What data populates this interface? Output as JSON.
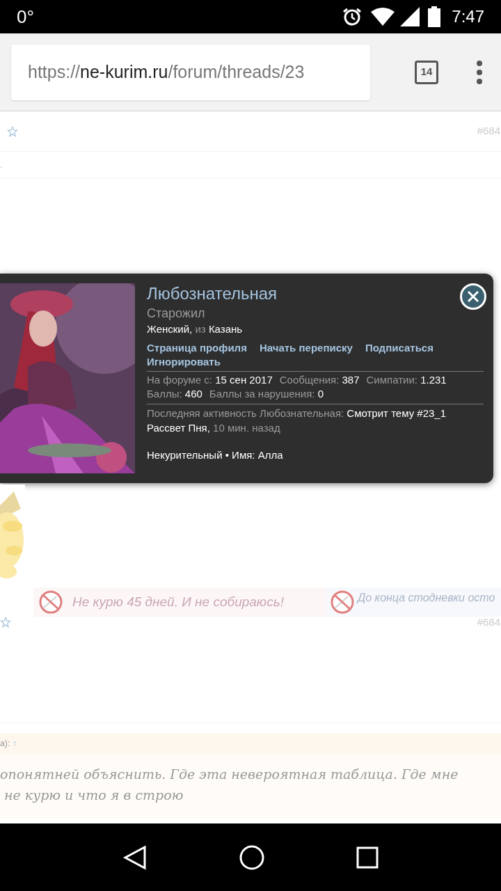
{
  "status_bar": {
    "temperature": "0°",
    "time": "7:47"
  },
  "browser": {
    "url_scheme": "https://",
    "url_host": "ne-kurim.ru",
    "url_path": "/forum/threads/23",
    "tab_count": "14"
  },
  "top_post": {
    "post_number": "#684",
    "fragment": "."
  },
  "popup": {
    "name": "Любознательная",
    "rank": "Старожил",
    "gender": "Женский,",
    "from": "из",
    "city": "Казань",
    "links": [
      "Страница профиля",
      "Начать переписку",
      "Подписаться",
      "Игнорировать"
    ],
    "stats": [
      [
        {
          "label": "На форуме с:",
          "value": "15 сен 2017"
        },
        {
          "label": "Сообщения:",
          "value": "387"
        },
        {
          "label": "Симпатии:",
          "value": "1.231"
        }
      ],
      [
        {
          "label": "Баллы:",
          "value": "460"
        },
        {
          "label": "Баллы за нарушения:",
          "value": "0"
        }
      ]
    ],
    "activity_label": "Последняя активность Любознательная:",
    "activity_value": "Смотрит тему #23_1 Рассвет Пня,",
    "activity_time": "10 мин. назад",
    "footer": "Некурительный • Имя: Алла"
  },
  "signatures": [
    {
      "text": "Не курю 45 дней. И не собираюсь!"
    },
    {
      "text": "До конца стодневки осто"
    }
  ],
  "second_post": {
    "post_number": "#684"
  },
  "quote": {
    "attribution": "а):",
    "arrow": "↑",
    "lines": [
      "опонятней объяснить. Где эта невероятная таблица. Где мне",
      "не курю и что я в строю"
    ]
  }
}
